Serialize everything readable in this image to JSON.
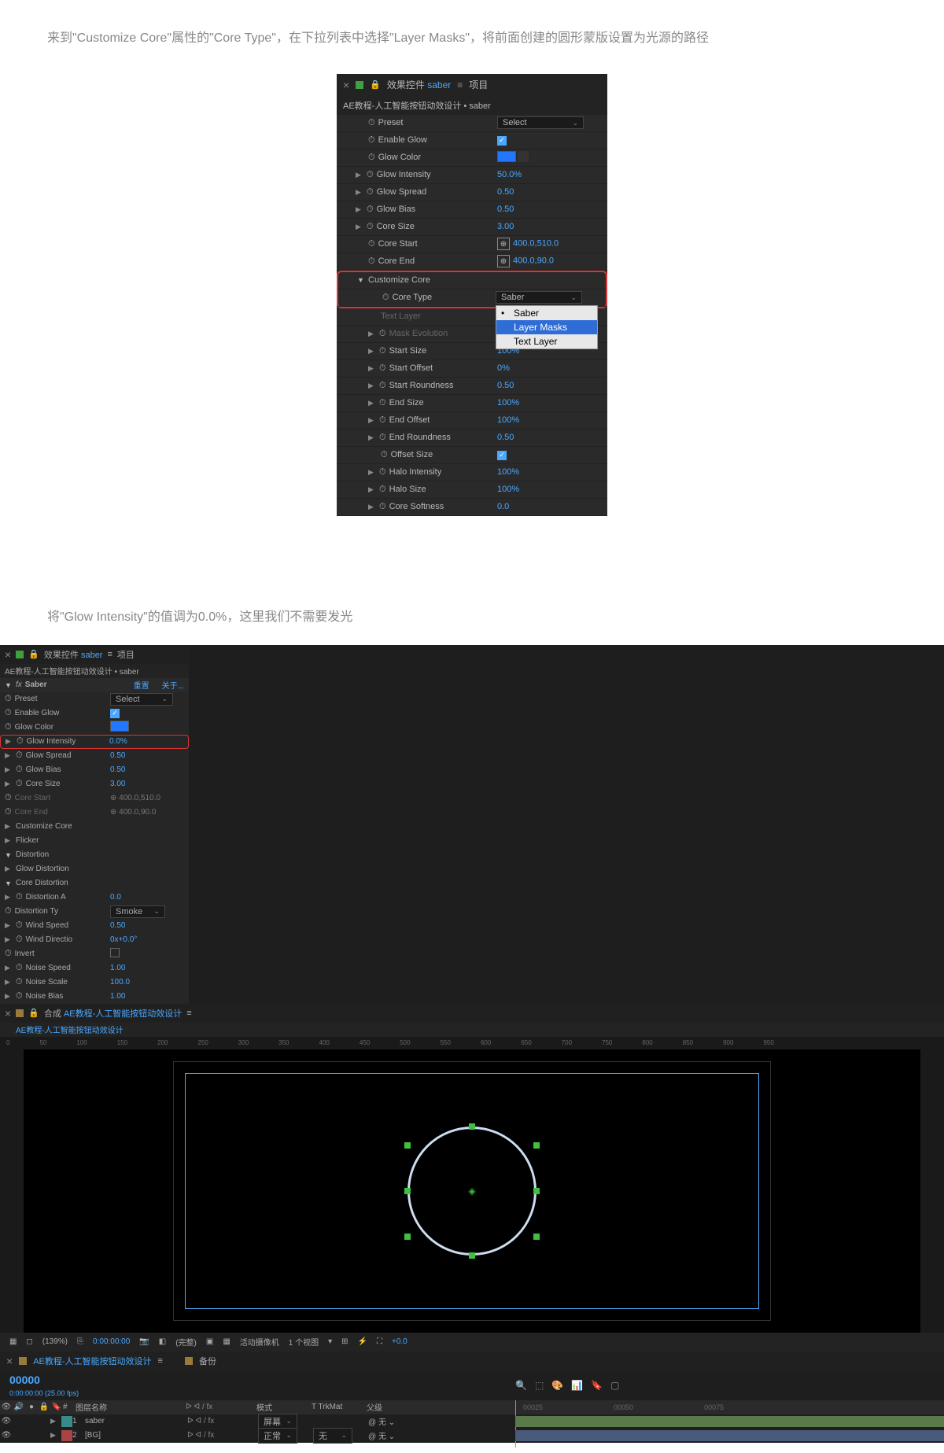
{
  "desc1": "来到\"Customize Core\"属性的\"Core Type\"，在下拉列表中选择\"Layer Masks\"，将前面创建的圆形蒙版设置为光源的路径",
  "desc2": "将\"Glow Intensity\"的值调为0.0%，这里我们不需要发光",
  "panel1": {
    "tab_effect": "效果控件",
    "tab_effect_name": "saber",
    "tab_project": "项目",
    "breadcrumb": "AE教程-人工智能按钮动效设计 • saber",
    "preset": {
      "label": "Preset",
      "value": "Select"
    },
    "enable_glow": {
      "label": "Enable Glow"
    },
    "glow_color": {
      "label": "Glow Color"
    },
    "glow_intensity": {
      "label": "Glow Intensity",
      "value": "50.0%"
    },
    "glow_spread": {
      "label": "Glow Spread",
      "value": "0.50"
    },
    "glow_bias": {
      "label": "Glow Bias",
      "value": "0.50"
    },
    "core_size": {
      "label": "Core Size",
      "value": "3.00"
    },
    "core_start": {
      "label": "Core Start",
      "value": "400.0,510.0"
    },
    "core_end": {
      "label": "Core End",
      "value": "400.0,90.0"
    },
    "customize_core": {
      "label": "Customize Core"
    },
    "core_type": {
      "label": "Core Type",
      "value": "Saber"
    },
    "text_layer": {
      "label": "Text Layer"
    },
    "dd": {
      "opt1": "Saber",
      "opt2": "Layer Masks",
      "opt3": "Text Layer"
    },
    "mask_evolution": {
      "label": "Mask Evolution"
    },
    "start_size": {
      "label": "Start Size",
      "value": "100%"
    },
    "start_offset": {
      "label": "Start Offset",
      "value": "0%"
    },
    "start_roundness": {
      "label": "Start Roundness",
      "value": "0.50"
    },
    "end_size": {
      "label": "End Size",
      "value": "100%"
    },
    "end_offset": {
      "label": "End Offset",
      "value": "100%"
    },
    "end_roundness": {
      "label": "End Roundness",
      "value": "0.50"
    },
    "offset_size": {
      "label": "Offset Size"
    },
    "halo_intensity": {
      "label": "Halo Intensity",
      "value": "100%"
    },
    "halo_size": {
      "label": "Halo Size",
      "value": "100%"
    },
    "core_softness": {
      "label": "Core Softness",
      "value": "0.0"
    }
  },
  "panel2": {
    "tab_effect": "效果控件",
    "tab_effect_name": "saber",
    "tab_project": "项目",
    "breadcrumb": "AE教程-人工智能按钮动效设计 • saber",
    "fx_name": "Saber",
    "reset": "重置",
    "about": "关于...",
    "preset": {
      "label": "Preset",
      "value": "Select"
    },
    "enable_glow": {
      "label": "Enable Glow"
    },
    "glow_color": {
      "label": "Glow Color"
    },
    "glow_intensity": {
      "label": "Glow Intensity",
      "value": "0.0%"
    },
    "glow_spread": {
      "label": "Glow Spread",
      "value": "0.50"
    },
    "glow_bias": {
      "label": "Glow Bias",
      "value": "0.50"
    },
    "core_size": {
      "label": "Core Size",
      "value": "3.00"
    },
    "core_start": {
      "label": "Core Start",
      "value": "400.0,510.0"
    },
    "core_end": {
      "label": "Core End",
      "value": "400.0,90.0"
    },
    "customize_core": {
      "label": "Customize Core"
    },
    "flicker": {
      "label": "Flicker"
    },
    "distortion": {
      "label": "Distortion"
    },
    "glow_distortion": {
      "label": "Glow Distortion"
    },
    "core_distortion": {
      "label": "Core Distortion"
    },
    "distortion_a": {
      "label": "Distortion A",
      "value": "0.0"
    },
    "distortion_ty": {
      "label": "Distortion Ty",
      "value": "Smoke"
    },
    "wind_speed": {
      "label": "Wind Speed",
      "value": "0.50"
    },
    "wind_direction": {
      "label": "Wind Directio",
      "value": "0x+0.0°"
    },
    "invert": {
      "label": "Invert"
    },
    "noise_speed": {
      "label": "Noise Speed",
      "value": "1.00"
    },
    "noise_scale": {
      "label": "Noise Scale",
      "value": "100.0"
    },
    "noise_bias": {
      "label": "Noise Bias",
      "value": "1.00"
    },
    "comp_tab": "合成",
    "comp_name": "AE教程-人工智能按钮动效设计",
    "comp_name2": "AE教程-人工智能按钮动效设计",
    "zoom": "(139%)",
    "res": "(完整)",
    "camera": "活动摄像机",
    "views": "1 个视图",
    "exposure": "+0.0",
    "ruler_ticks": [
      "0",
      "50",
      "100",
      "150",
      "200",
      "250",
      "300",
      "350",
      "400",
      "450",
      "500",
      "550",
      "600",
      "650",
      "700",
      "750",
      "800",
      "850",
      "900",
      "950"
    ],
    "timecode": "00000",
    "timecode_sub": "0:00:00:00 (25.00 fps)",
    "backup": "备份",
    "col_layer_name": "图层名称",
    "col_mode": "模式",
    "col_trkmat": "TrkMat",
    "col_parent": "父级",
    "layer1": {
      "num": "1",
      "name": "saber",
      "mode": "屏幕",
      "parent": "无"
    },
    "layer2": {
      "num": "2",
      "name": "[BG]",
      "mode": "正常",
      "parent": "无"
    },
    "switches_label": "ᐅ ᐊ / fx",
    "tl_ticks": [
      "00025",
      "00050",
      "00075"
    ]
  }
}
